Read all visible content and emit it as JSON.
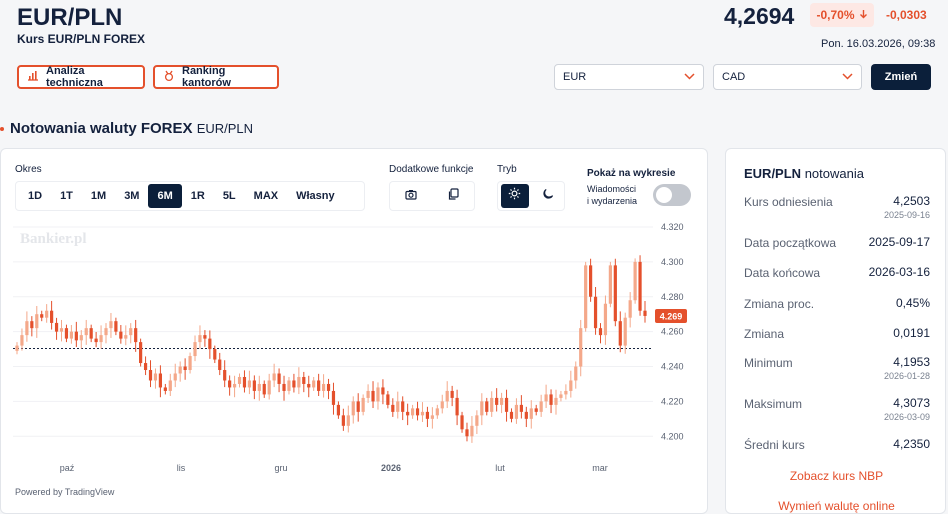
{
  "header": {
    "pair": "EUR/PLN",
    "subtitle": "Kurs EUR/PLN FOREX",
    "rate": "4,2694",
    "pct_change": "-0,70%",
    "abs_change": "-0,0303",
    "datetime": "Pon. 16.03.2026, 09:38",
    "btn_analysis": "Analiza techniczna",
    "btn_ranking": "Ranking kantorów",
    "currency_from": "EUR",
    "currency_to": "CAD",
    "btn_change": "Zmień"
  },
  "section": {
    "title": "Notowania waluty FOREX",
    "pair": "EUR/PLN"
  },
  "controls": {
    "period_label": "Okres",
    "periods": [
      "1D",
      "1T",
      "1M",
      "3M",
      "6M",
      "1R",
      "5L",
      "MAX",
      "Własny"
    ],
    "active_period": "6M",
    "extra_label": "Dodatkowe funkcje",
    "mode_label": "Tryb",
    "show_label": "Pokaż na wykresie",
    "events_label_1": "Wiadomości",
    "events_label_2": "i wydarzenia"
  },
  "chart_data": {
    "type": "candlestick",
    "watermark": "Bankier.pl",
    "powered": "Powered by TradingView",
    "x_ticks": [
      "paź",
      "lis",
      "gru",
      "2026",
      "lut",
      "mar"
    ],
    "y_ticks": [
      "4.320",
      "4.300",
      "4.280",
      "4.260",
      "4.240",
      "4.220",
      "4.200"
    ],
    "ylim": [
      4.195,
      4.32
    ],
    "reference_line": 4.2503,
    "last_value": "4.269",
    "up_color": "#f4a88a",
    "down_color": "#e4502c",
    "closes": [
      4.252,
      4.258,
      4.266,
      4.262,
      4.27,
      4.268,
      4.272,
      4.265,
      4.26,
      4.262,
      4.256,
      4.26,
      4.255,
      4.258,
      4.262,
      4.256,
      4.254,
      4.258,
      4.262,
      4.266,
      4.26,
      4.256,
      4.258,
      4.262,
      4.254,
      4.242,
      4.238,
      4.232,
      4.236,
      4.228,
      4.226,
      4.232,
      4.236,
      4.24,
      4.238,
      4.246,
      4.254,
      4.258,
      4.256,
      4.25,
      4.244,
      4.238,
      4.232,
      4.228,
      4.23,
      4.234,
      4.228,
      4.232,
      4.226,
      4.23,
      4.224,
      4.232,
      4.236,
      4.23,
      4.226,
      4.232,
      4.228,
      4.234,
      4.23,
      4.228,
      4.232,
      4.226,
      4.23,
      4.226,
      4.218,
      4.212,
      4.206,
      4.212,
      4.22,
      4.214,
      4.222,
      4.226,
      4.22,
      4.228,
      4.224,
      4.218,
      4.214,
      4.22,
      4.214,
      4.212,
      4.216,
      4.212,
      4.214,
      4.21,
      4.212,
      4.216,
      4.22,
      4.226,
      4.222,
      4.212,
      4.204,
      4.2,
      4.206,
      4.212,
      4.22,
      4.214,
      4.222,
      4.218,
      4.222,
      4.214,
      4.21,
      4.218,
      4.214,
      4.21,
      4.216,
      4.214,
      4.22,
      4.224,
      4.218,
      4.222,
      4.224,
      4.226,
      4.232,
      4.24,
      4.262,
      4.298,
      4.28,
      4.262,
      4.258,
      4.276,
      4.298,
      4.266,
      4.252,
      4.268,
      4.278,
      4.3,
      4.272,
      4.269
    ],
    "minimum": 4.1953,
    "maximum": 4.3073
  },
  "side": {
    "title_bold": "EUR/PLN",
    "title_rest": "notowania",
    "rows": [
      {
        "label": "Kurs odniesienia",
        "value": "4,2503",
        "date": "2025-09-16"
      },
      {
        "label": "Data początkowa",
        "value": "2025-09-17",
        "date": ""
      },
      {
        "label": "Data końcowa",
        "value": "2026-03-16",
        "date": ""
      },
      {
        "label": "Zmiana proc.",
        "value": "0,45%",
        "date": ""
      },
      {
        "label": "Zmiana",
        "value": "0,0191",
        "date": ""
      },
      {
        "label": "Minimum",
        "value": "4,1953",
        "date": "2026-01-28"
      },
      {
        "label": "Maksimum",
        "value": "4,3073",
        "date": "2026-03-09"
      },
      {
        "label": "Średni kurs",
        "value": "4,2350",
        "date": ""
      }
    ],
    "link_nbp": "Zobacz kurs NBP",
    "link_exchange": "Wymień walutę online"
  }
}
